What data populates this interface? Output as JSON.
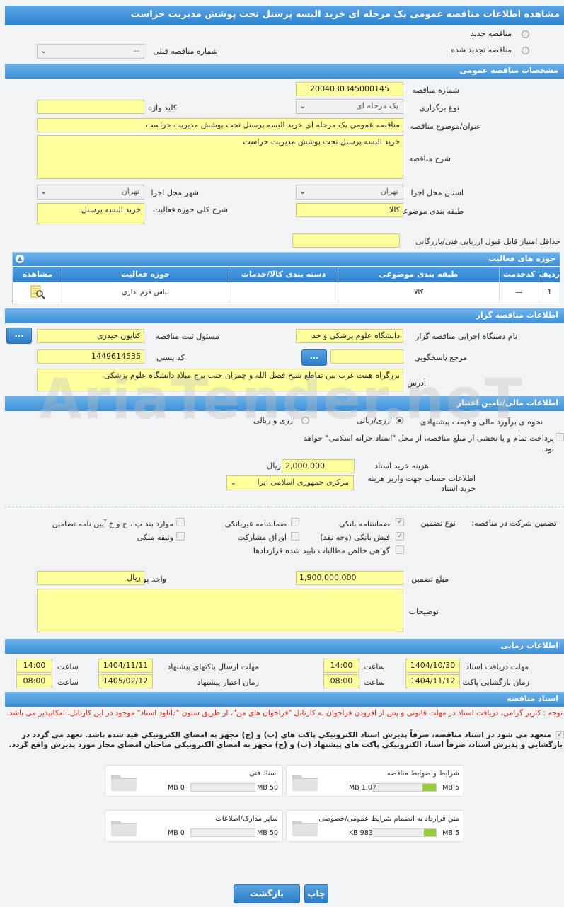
{
  "title": "مشاهده اطلاعات مناقصه عمومی یک مرحله ای خرید البسه پرسنل تحت پوشش مدیریت حراست",
  "top": {
    "new_tender": "مناقصه جدید",
    "renewed_tender": "مناقصه تجدید شده",
    "prev_number_label": "شماره مناقصه قبلی",
    "prev_number_value": "--"
  },
  "general": {
    "section": "مشخصات مناقصه عمومی",
    "number_label": "شماره مناقصه",
    "number_value": "2004030345000145",
    "hold_type_label": "نوع برگزاری",
    "hold_type_value": "یک مرحله ای",
    "keyword_label": "کلید واژه",
    "keyword_value": "",
    "subject_label": "عنوان/موضوع مناقصه",
    "subject_value": "مناقصه عمومی یک مرحله ای خرید البسه پرسنل تحت پوشش مدیریت حراست",
    "desc_label": "شرح مناقصه",
    "desc_value": "خرید البسه پرسنل تحت پوشش مدیریت حراست",
    "province_label": "استان محل اجرا",
    "province_value": "تهران",
    "city_label": "شهر محل اجرا",
    "city_value": "تهران",
    "category_label": "طبقه بندی موضوعی",
    "category_value": "کالا",
    "activity_desc_label": "شرح کلی حوزه فعالیت",
    "activity_desc_value": "خرید البسه پرسنل",
    "min_score_label": "حداقل امتیاز قابل قبول ارزیابی فنی/بازرگانی",
    "min_score_value": ""
  },
  "activity_table": {
    "title": "حوزه های فعالیت",
    "headers": [
      "ردیف",
      "کدخدمت",
      "طبقه بندی موضوعی",
      "دسته بندی کالا/خدمات",
      "حوزه فعالیت",
      "مشاهده"
    ],
    "row": [
      "1",
      "—",
      "کالا",
      "",
      "لباس فرم اداری",
      ""
    ]
  },
  "organizer": {
    "section": "اطلاعات مناقصه گزار",
    "org_label": "نام دستگاه اجرایی مناقصه گزار",
    "org_value": "دانشگاه علوم پزشکی و خد",
    "registrar_label": "مسئول ثبت مناقصه",
    "registrar_value": "کتایون حیدری",
    "ref_label": "مرجع پاسخگویی",
    "ref_value": "",
    "postal_label": "کد پستی",
    "postal_value": "1449614535",
    "address_label": "آدرس",
    "address_value": "بزرگراه همت غرب بین تقاطع شیخ فضل الله و چمران جنب برج میلاد دانشگاه علوم پزشکی",
    "dots": "..."
  },
  "finance": {
    "section": "اطلاعات مالی/تامین اعتبار",
    "estimate_label": "نحوه ی برآورد مالی و قیمت پیشنهادی",
    "opt_currency": "ارزی/ریالی",
    "opt_currency2": "ارزی و ریالی",
    "treasury_text": "پرداخت تمام و یا بخشی از مبلغ مناقصه، از محل \"اسناد خزانه اسلامی\" خواهد بود.",
    "doc_cost_label": "هزینه خرید اسناد",
    "doc_cost_value": "2,000,000",
    "doc_cost_unit": "ریال",
    "account_label": "اطلاعات حساب جهت واریز هزینه خرید اسناد",
    "account_value": "مرکزی جمهوری اسلامی ایرا"
  },
  "guarantee": {
    "participation_label": "تضمین شرکت در مناقصه:",
    "type_label": "نوع تضمین",
    "items": [
      "ضمانتنامه بانکی",
      "ضمانتنامه غیربانکی",
      "موارد بند پ ، ج و خ آیین نامه تضامین",
      "فیش بانکی (وجه نقد)",
      "اوراق مشارکت",
      "وثیقه ملکی",
      "گواهی خالص مطالبات تایید شده قراردادها"
    ],
    "amount_label": "مبلغ تضمین",
    "amount_value": "1,900,000,000",
    "currency_label": "واحد پول",
    "currency_value": "ریال",
    "notes_label": "توضیحات",
    "notes_value": ""
  },
  "timing": {
    "section": "اطلاعات زمانی",
    "doc_receive_label": "مهلت دریافت اسناد",
    "doc_receive_date": "1404/10/30",
    "doc_receive_time": "14:00",
    "send_label": "مهلت ارسال پاکتهای پیشنهاد",
    "send_date": "1404/11/11",
    "send_time": "14:00",
    "open_label": "زمان بازگشایی پاکت ها",
    "open_date": "1404/11/12",
    "open_time": "08:00",
    "valid_label": "زمان اعتبار پیشنهاد",
    "valid_date": "1405/02/12",
    "valid_time": "08:00",
    "time_word": "ساعت"
  },
  "documents": {
    "section": "اسناد مناقصه",
    "note": "توجه : کاربر گرامی، دریافت اسناد در مهلت قانونی و پس از افزودن فراخوان به کارتابل \"فراخوان های من\"، از طریق ستون \"دانلود اسناد\" موجود در این کارتابل، امکانپذیر می باشد.",
    "commit": "متعهد می شود در اسناد مناقصه، صرفاً پذیرش اسناد الکترونیکی پاکت های (ب) و (ج) مجهز به امضای الکترونیکی قید شده باشد. تعهد می گردد در بازگشایی و پذیرش اسناد، صرفاً اسناد الکترونیکی پاکت های پیشنهاد (ب) و (ج) مجهز به امضای الکترونیکی صاحبان امضای مجاز مورد پذیرش واقع گردد.",
    "boxes": [
      {
        "title": "شرایط و ضوابط مناقصه",
        "current": "1.07 MB",
        "max": "5 MB",
        "fill": 0.21
      },
      {
        "title": "اسناد فنی",
        "current": "0 MB",
        "max": "50 MB",
        "fill": 0
      },
      {
        "title": "متن قرارداد به انضمام شرایط عمومی/خصوصی",
        "current": "983 KB",
        "max": "5 MB",
        "fill": 0.19
      },
      {
        "title": "سایر مدارک/اطلاعات",
        "current": "0 MB",
        "max": "50 MB",
        "fill": 0
      }
    ]
  },
  "buttons": {
    "print": "چاپ",
    "back": "بازگشت"
  },
  "watermark": "AriaTender.neT"
}
